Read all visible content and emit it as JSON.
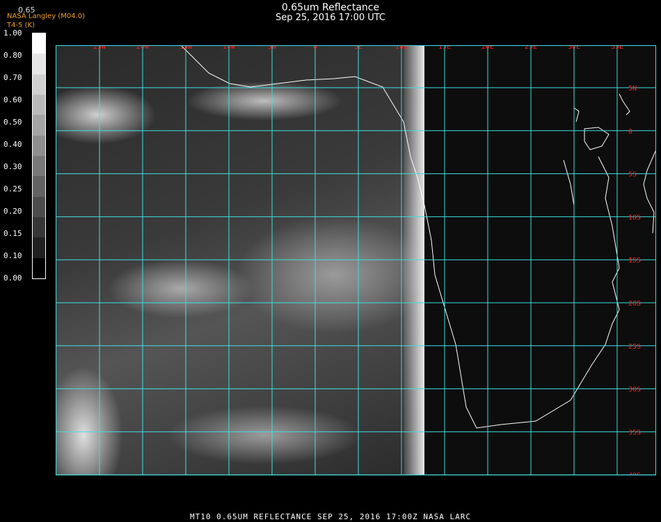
{
  "title": {
    "line1": "0.65um Reflectance",
    "line2": "Sep 25, 2016 17:00 UTC"
  },
  "org": {
    "line1": "NASA Langley (M04.0)",
    "line2": "T4-5 (K)"
  },
  "sensor": "0.65",
  "colorbar": {
    "labels": [
      "1.00",
      "0.80",
      "0.70",
      "0.60",
      "0.50",
      "0.40",
      "0.30",
      "0.25",
      "0.20",
      "0.15",
      "0.10",
      "0.00"
    ],
    "colors": [
      "#ffffff",
      "#e6e6e6",
      "#d0d0d0",
      "#bababa",
      "#a4a4a4",
      "#8e8e8e",
      "#787878",
      "#626262",
      "#4c4c4c",
      "#363636",
      "#202020",
      "#000000"
    ]
  },
  "grid": {
    "lon_labels": [
      "25W",
      "20W",
      "15W",
      "10W",
      "5W",
      "0",
      "5E",
      "10E",
      "15E",
      "20E",
      "25E",
      "30E",
      "35E"
    ],
    "lat_labels": [
      "5N",
      "0",
      "5S",
      "10S",
      "15S",
      "20S",
      "25S",
      "30S",
      "35S",
      "40S"
    ],
    "grid_color": "#40e0e0",
    "label_color": "#ff2020"
  },
  "footer": "MT10  0.65UM REFLECTANCE   SEP 25, 2016 17:00Z   NASA LARC"
}
